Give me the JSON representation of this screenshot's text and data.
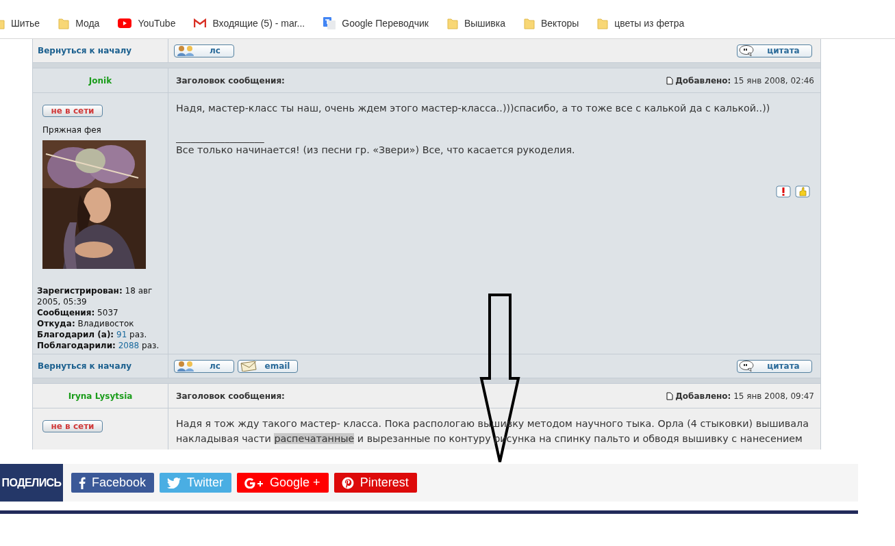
{
  "bookmarks": [
    {
      "kind": "folder",
      "label": "Шитье"
    },
    {
      "kind": "folder",
      "label": "Мода"
    },
    {
      "kind": "youtube",
      "label": "YouTube"
    },
    {
      "kind": "gmail",
      "label": "Входящие (5) - mar..."
    },
    {
      "kind": "translate",
      "label": "Google Переводчик"
    },
    {
      "kind": "folder",
      "label": "Вышивка"
    },
    {
      "kind": "folder",
      "label": "Векторы"
    },
    {
      "kind": "folder",
      "label": "цветы из фетра"
    }
  ],
  "forum": {
    "previous_footer": {
      "shaded": false,
      "back_link": "Вернуться к началу",
      "buttons": [
        {
          "kind": "pm",
          "label": "лс"
        }
      ],
      "quote_button": "цитата"
    },
    "posts": [
      {
        "shaded": true,
        "author": "Jonik",
        "subject_label": "Заголовок сообщения:",
        "added_label": "Добавлено:",
        "date": "15 янв 2008, 02:46",
        "status_button": "не в сети",
        "rank": "Пряжная фея",
        "avatar": {
          "kind": "picture"
        },
        "profile": [
          {
            "label": "Зарегистрирован:",
            "value": "18 авг 2005, 05:39"
          },
          {
            "label": "Сообщения:",
            "value": "5037"
          },
          {
            "label": "Откуда:",
            "value": "Владивосток"
          },
          {
            "label": "Благодарил (а):",
            "link": "91",
            "value": "раз."
          },
          {
            "label": "Поблагодарили:",
            "link": "2088",
            "value": "раз."
          }
        ],
        "message": [
          {
            "kind": "text",
            "segments": [
              {
                "text": "Надя, мастер-класс ты наш, очень ждем этого мастер-класса..)))спасибо, а то тоже все с калькой да с калькой..))",
                "selected": false
              }
            ]
          },
          {
            "kind": "signature_rule",
            "text": "__________________"
          },
          {
            "kind": "text",
            "segments": [
              {
                "text": "Все только начинается! (из песни гр. «Звери») Все, что касается рукоделия.",
                "selected": false
              }
            ]
          }
        ],
        "actions": [
          {
            "kind": "report"
          },
          {
            "kind": "thanks"
          }
        ],
        "footer": {
          "shaded": true,
          "back_link": "Вернуться к началу",
          "buttons": [
            {
              "kind": "pm",
              "label": "лс"
            },
            {
              "kind": "email",
              "label": "email"
            }
          ],
          "quote_button": "цитата"
        }
      },
      {
        "shaded": false,
        "author": "Iryna Lysytsia",
        "subject_label": "Заголовок сообщения:",
        "added_label": "Добавлено:",
        "date": "15 янв 2008, 09:47",
        "status_button": "не в сети",
        "message": [
          {
            "kind": "text",
            "segments": [
              {
                "text": "Надя я тож жду такого мастер- класса. Пока распологаю вышивку методом научного тыка. Орла (4 стыковки) вышивала накладывая части ",
                "selected": false
              },
              {
                "text": "распечатанные",
                "selected": true
              },
              {
                "text": " и вырезанные по контуру рисунка на спинку пальто и обводя вышивку с нанесением",
                "selected": false
              }
            ]
          }
        ]
      }
    ]
  },
  "share": {
    "label": "ПОДЕЛИСЬ",
    "buttons": [
      {
        "kind": "facebook",
        "label": "Facebook"
      },
      {
        "kind": "twitter",
        "label": "Twitter"
      },
      {
        "kind": "googleplus",
        "label": "Google +"
      },
      {
        "kind": "pinterest",
        "label": "Pinterest"
      }
    ]
  },
  "annotation": {
    "kind": "arrow"
  }
}
